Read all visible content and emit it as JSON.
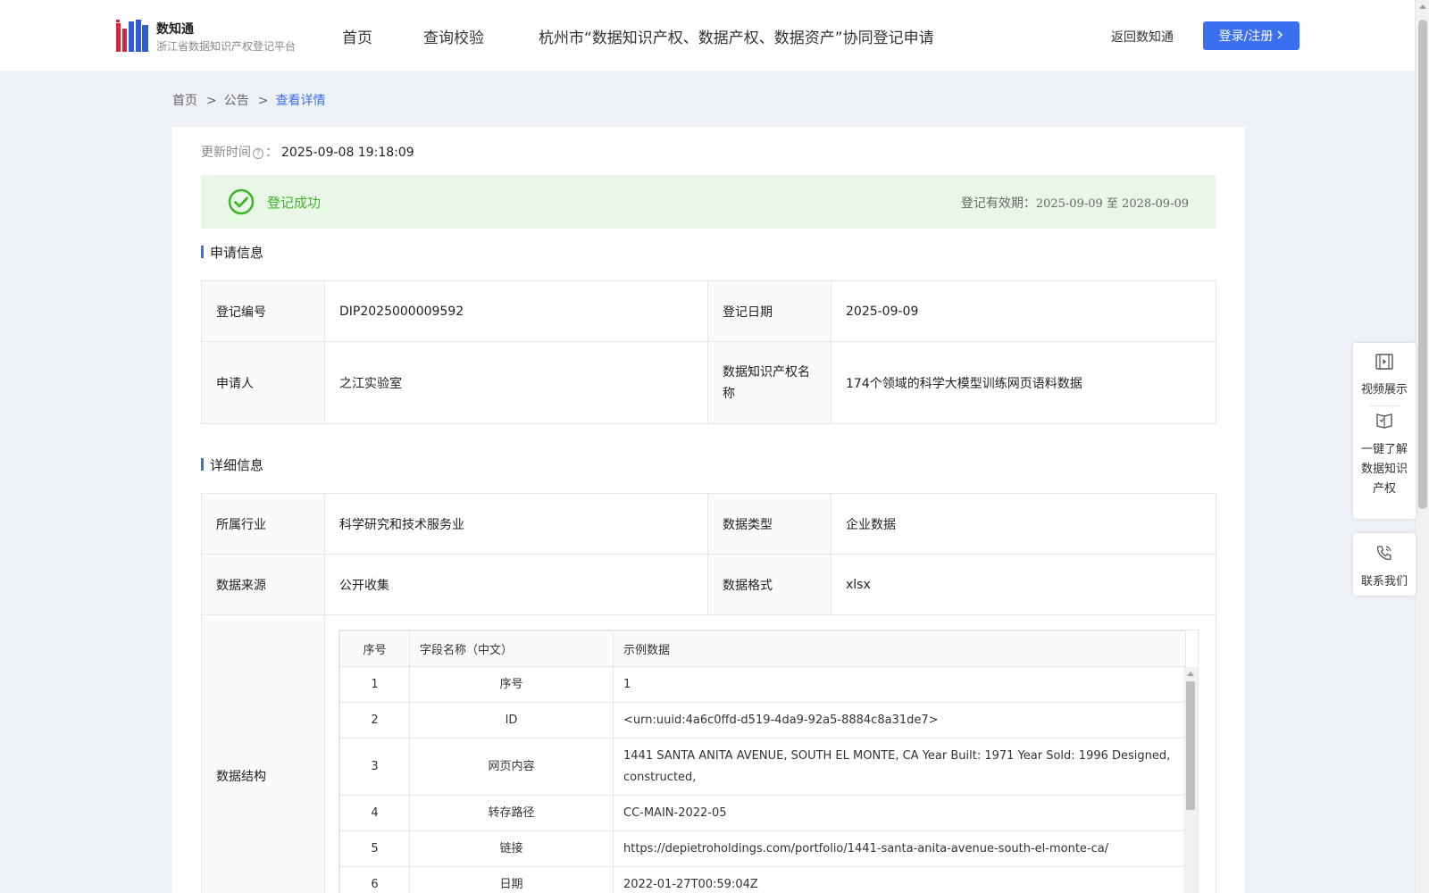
{
  "header": {
    "brand_name": "数知通",
    "brand_sub": "浙江省数据知识产权登记平台",
    "nav": [
      "首页",
      "查询校验",
      "杭州市“数据知识产权、数据产权、数据资产”协同登记申请"
    ],
    "back_link": "返回数知通",
    "login_button": "登录/注册"
  },
  "breadcrumb": [
    "首页",
    "公告",
    "查看详情"
  ],
  "update": {
    "label": "更新时间",
    "suffix": "：",
    "value": "2025-09-08 19:18:09"
  },
  "status": {
    "text": "登记成功",
    "validity_label": "登记有效期：",
    "validity_dates": "2025-09-09 至 2028-09-09"
  },
  "colors": {
    "accent": "#3a6ff0",
    "success": "#3fb52a",
    "success_bg": "#e9f7e6"
  },
  "application": {
    "title": "申请信息",
    "rows": [
      [
        "登记编号",
        "DIP2025000009592",
        "登记日期",
        "2025-09-09"
      ],
      [
        "申请人",
        "之江实验室",
        "数据知识产权名称",
        "174个领域的科学大模型训练网页语料数据"
      ]
    ]
  },
  "details": {
    "title": "详细信息",
    "rows": [
      [
        "所属行业",
        "科学研究和技术服务业",
        "数据类型",
        "企业数据"
      ],
      [
        "数据来源",
        "公开收集",
        "数据格式",
        "xlsx"
      ]
    ],
    "structure_label": "数据结构",
    "schema": {
      "headers": [
        "序号",
        "字段名称（中文）",
        "示例数据"
      ],
      "rows": [
        [
          "1",
          "序号",
          "1"
        ],
        [
          "2",
          "ID",
          "<urn:uuid:4a6c0ffd-d519-4da9-92a5-8884c8a31de7>"
        ],
        [
          "3",
          "网页内容",
          "1441 SANTA ANITA AVENUE, SOUTH EL MONTE, CA Year Built: 1971 Year Sold: 1996 Designed, constructed,"
        ],
        [
          "4",
          "转存路径",
          "CC-MAIN-2022-05"
        ],
        [
          "5",
          "链接",
          "https://depietroholdings.com/portfolio/1441-santa-anita-avenue-south-el-monte-ca/"
        ],
        [
          "6",
          "日期",
          "2022-01-27T00:59:04Z"
        ]
      ]
    }
  },
  "float_panel": {
    "video": "视频展示",
    "learn": [
      "一键了解",
      "数据知识",
      "产权"
    ],
    "contact": "联系我们"
  }
}
